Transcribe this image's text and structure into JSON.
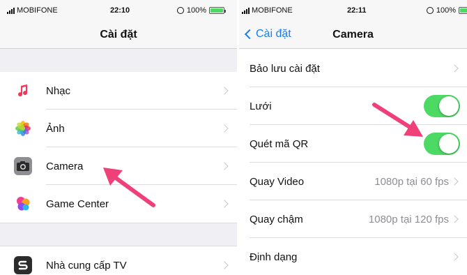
{
  "left": {
    "status": {
      "carrier": "MOBIFONE",
      "time": "22:10",
      "battery": "100%"
    },
    "title": "Cài đặt",
    "items": [
      {
        "label": "Nhạc",
        "icon": "music-note-icon"
      },
      {
        "label": "Ảnh",
        "icon": "photos-flower-icon"
      },
      {
        "label": "Camera",
        "icon": "camera-icon"
      },
      {
        "label": "Game Center",
        "icon": "game-center-bubbles-icon"
      }
    ],
    "items2": [
      {
        "label": "Nhà cung cấp TV",
        "icon": "tv-provider-icon"
      }
    ]
  },
  "right": {
    "status": {
      "carrier": "MOBIFONE",
      "time": "22:11",
      "battery": "100%"
    },
    "back_label": "Cài đặt",
    "title": "Camera",
    "rows": [
      {
        "label": "Bảo lưu cài đặt",
        "type": "disclosure"
      },
      {
        "label": "Lưới",
        "type": "toggle",
        "on": true
      },
      {
        "label": "Quét mã QR",
        "type": "toggle",
        "on": true
      },
      {
        "label": "Quay Video",
        "value": "1080p tại 60 fps",
        "type": "disclosure"
      },
      {
        "label": "Quay chậm",
        "value": "1080p tại 120 fps",
        "type": "disclosure"
      },
      {
        "label": "Định dạng",
        "type": "disclosure"
      }
    ]
  },
  "colors": {
    "accent": "#1a7cf0",
    "toggle_on": "#4cd964",
    "arrow": "#f0407a",
    "background": "#efeff4"
  }
}
